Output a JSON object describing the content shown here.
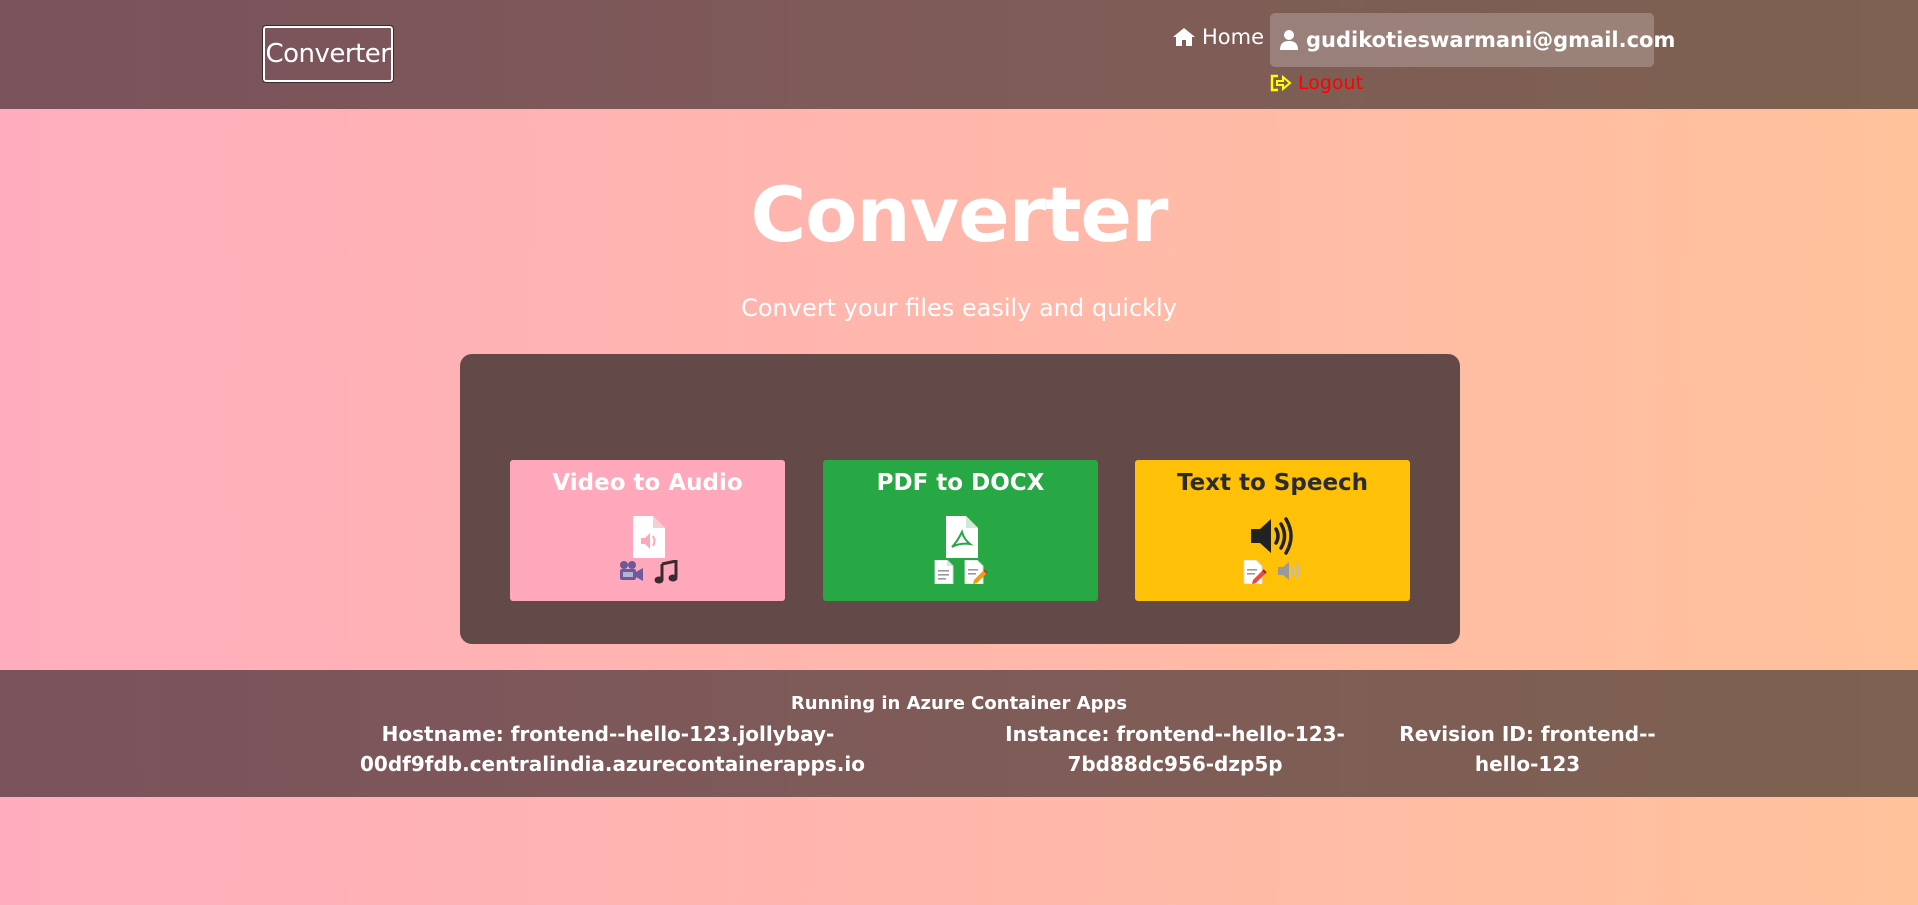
{
  "header": {
    "brand": "Converter",
    "home_label": "Home",
    "user_email": "gudikotieswarmani@gmail.com",
    "logout_label": "Logout"
  },
  "hero": {
    "title": "Converter",
    "subtitle": "Convert your files easily and quickly"
  },
  "cards": [
    {
      "title": "Video to Audio",
      "main_icon": "audio-file-icon",
      "sub_icons": [
        "video-camera-icon",
        "music-note-icon"
      ],
      "color": "#ffa8bb"
    },
    {
      "title": "PDF to DOCX",
      "main_icon": "pdf-file-icon",
      "sub_icons": [
        "document-icon",
        "edit-document-icon"
      ],
      "color": "#28a745"
    },
    {
      "title": "Text to Speech",
      "main_icon": "speaker-icon",
      "sub_icons": [
        "edit-document-icon",
        "speaker-icon"
      ],
      "color": "#ffc107"
    }
  ],
  "footer": {
    "title": "Running in Azure Container Apps",
    "hostname_line1": "Hostname: frontend--hello-123.jollybay-",
    "hostname_line2": "00df9fdb.centralindia.azurecontainerapps.io",
    "instance_line1": "Instance: frontend--hello-123-",
    "instance_line2": "7bd88dc956-dzp5p",
    "revision_line1": "Revision ID: frontend--",
    "revision_line2": "hello-123"
  },
  "colors": {
    "header_bg": "#7f5b58",
    "panel_bg": "#634a48",
    "logout": "#ff0000",
    "logout_icon": "#ffff00"
  }
}
